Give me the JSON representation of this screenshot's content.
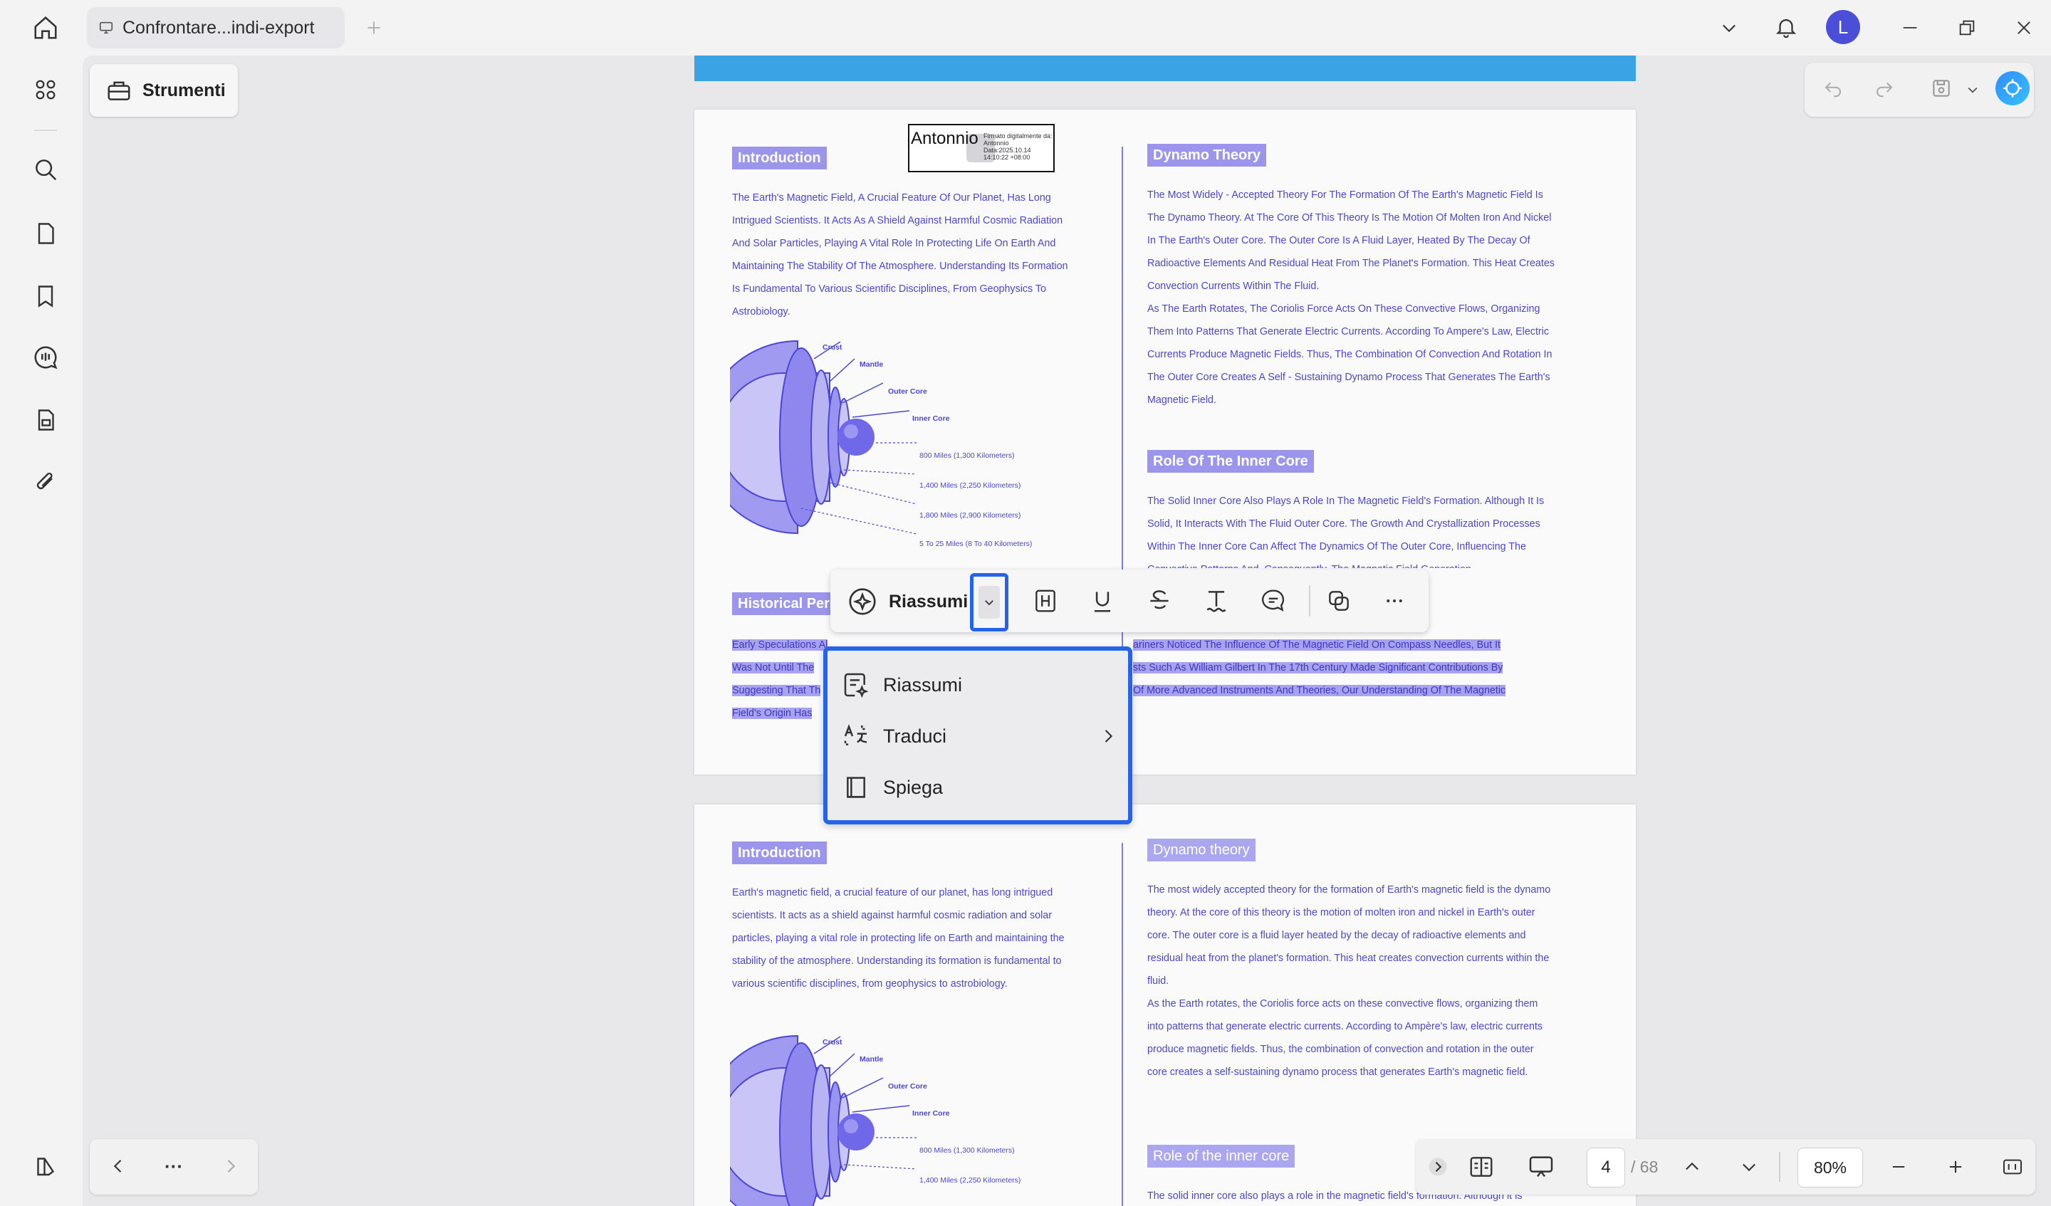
{
  "titlebar": {
    "tab_title": "Confrontare...indi-export",
    "avatar_letter": "L"
  },
  "toolbar": {
    "strumenti_label": "Strumenti"
  },
  "floating_toolbar": {
    "riassumi_label": "Riassumi"
  },
  "menu": {
    "items": [
      {
        "label": "Riassumi",
        "icon": "summary-sparkle-icon"
      },
      {
        "label": "Traduci",
        "icon": "translate-icon"
      },
      {
        "label": "Spiega",
        "icon": "book-icon"
      }
    ]
  },
  "bottom": {
    "more_label": "···",
    "current_page": "4",
    "total_pages": "/ 68",
    "zoom": "80%"
  },
  "page1": {
    "signature_name": "Antonnio",
    "signature_meta": "Firmato digitalmente da: Antonnio Data:2025.10.14 14:10:22 +08:00",
    "intro_title": "Introduction",
    "intro_lines": [
      "The Earth's Magnetic Field, A Crucial Feature Of Our Planet, Has Long",
      "Intrigued Scientists. It Acts As A Shield Against Harmful Cosmic Radiation",
      "And Solar Particles, Playing A Vital Role In Protecting Life On Earth And",
      "Maintaining The Stability Of The Atmosphere. Understanding Its Formation",
      "Is Fundamental To Various Scientific Disciplines, From Geophysics To",
      "Astrobiology."
    ],
    "globe_labels": [
      "Crust",
      "Mantle",
      "Outer Core",
      "Inner Core"
    ],
    "distances": [
      "800 Miles (1,300 Kilometers)",
      "1,400 Miles (2,250 Kilometers)",
      "1,800 Miles (2,900 Kilometers)",
      "5 To 25 Miles (8 To 40 Kilometers)"
    ],
    "historical_title": "Historical Pers",
    "hist_left": [
      "Early Speculations Al",
      "Was Not Until The",
      "Suggesting That Th",
      "Field's Origin Has"
    ],
    "hist_right": [
      "ariners Noticed The Influence Of The Magnetic Field On Compass Needles, But It",
      "sts Such As William Gilbert In The 17th Century Made Significant Contributions By",
      "Of More Advanced Instruments And Theories, Our Understanding Of The Magnetic"
    ],
    "dynamo_title": "Dynamo Theory",
    "dynamo_lines": [
      "The Most Widely - Accepted Theory For The Formation Of The Earth's Magnetic Field Is",
      "The Dynamo Theory. At The Core Of This Theory Is The Motion Of Molten Iron And Nickel",
      "In The Earth's Outer Core. The Outer Core Is A Fluid Layer, Heated By The Decay Of",
      "Radioactive Elements And Residual Heat From The Planet's Formation. This Heat Creates",
      "Convection Currents Within The Fluid.",
      "As The Earth Rotates, The Coriolis Force Acts On These Convective Flows, Organizing",
      "Them Into Patterns That Generate Electric Currents. According To Ampere's Law, Electric",
      "Currents Produce Magnetic Fields. Thus, The Combination Of Convection And Rotation In",
      "The Outer Core Creates A Self - Sustaining Dynamo Process That Generates The Earth's",
      "Magnetic Field."
    ],
    "inner_core_title": "Role Of The Inner Core",
    "inner_core_lines": [
      "The Solid Inner Core Also Plays A Role In The Magnetic Field's Formation. Although It Is",
      "Solid, It Interacts With The Fluid Outer Core. The Growth And Crystallization Processes",
      "Within The Inner Core Can Affect The Dynamics Of The Outer Core, Influencing The",
      "Convective Patterns And, Consequently, The Magnetic Field Generation."
    ]
  },
  "page2": {
    "intro_title": "Introduction",
    "intro_lines": [
      "Earth's magnetic field, a crucial feature of our planet, has long intrigued",
      "scientists. It acts as a shield against harmful cosmic radiation and solar",
      "particles, playing a vital role in protecting life on Earth and maintaining the",
      "stability of the atmosphere. Understanding its formation is fundamental to",
      "various scientific disciplines, from geophysics to astrobiology."
    ],
    "globe_labels": [
      "Crust",
      "Mantle",
      "Outer Core",
      "Inner Core"
    ],
    "distances": [
      "800 Miles (1,300 Kilometers)",
      "1,400 Miles (2,250 Kilometers)"
    ],
    "dynamo_title": "Dynamo theory",
    "dynamo_lines": [
      "The most widely accepted theory for the formation of Earth's magnetic field is the dynamo",
      "theory. At the core of this theory is the motion of molten iron and nickel in Earth's outer",
      "core. The outer core is a fluid layer heated by the decay of radioactive elements and",
      "residual heat from the planet's formation. This heat creates convection currents within the",
      "fluid.",
      "As the Earth rotates, the Coriolis force acts on these convective flows, organizing them",
      "into patterns that generate electric currents. According to Ampère's law, electric currents",
      "produce magnetic fields. Thus, the combination of convection and rotation in the outer",
      "core creates a self-sustaining dynamo process that generates Earth's magnetic field."
    ],
    "inner_core_title": "Role of the inner core",
    "inner_core_line": "The solid inner core also plays a role in the magnetic field's formation. Although it is"
  }
}
